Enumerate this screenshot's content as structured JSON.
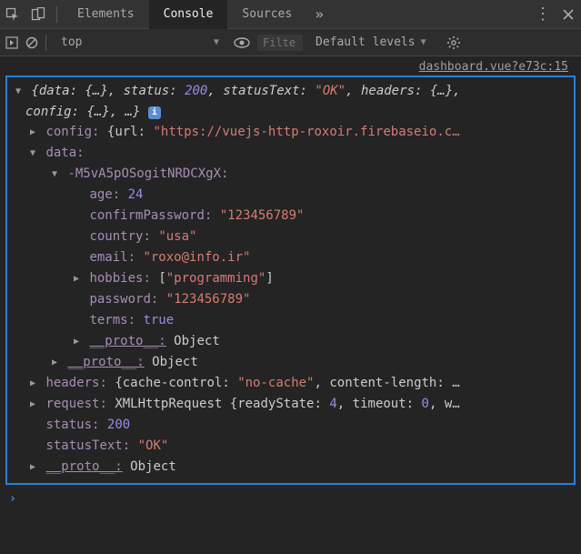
{
  "tabs": {
    "elements": "Elements",
    "console": "Console",
    "sources": "Sources"
  },
  "toolbar": {
    "context": "top",
    "filter_placeholder": "Filter",
    "levels": "Default levels"
  },
  "source_link": "dashboard.vue?e73c:15",
  "summary": {
    "data_k": "data:",
    "data_v": "{…}",
    "status_k": "status:",
    "status_v": "200",
    "statusText_k": "statusText:",
    "statusText_v": "\"OK\"",
    "headers_k": "headers:",
    "headers_v": "{…}",
    "config_k": "config:",
    "config_v": "{…}",
    "ellipsis": "…"
  },
  "config_line": {
    "k": "config:",
    "url_k": "url:",
    "url_v": "\"https://vuejs-http-roxoir.firebaseio.c…"
  },
  "data_key": "data:",
  "record_key": "-M5vA5pOSogitNRDCXgX:",
  "record": {
    "age_k": "age:",
    "age_v": "24",
    "cp_k": "confirmPassword:",
    "cp_v": "\"123456789\"",
    "country_k": "country:",
    "country_v": "\"usa\"",
    "email_k": "email:",
    "email_v": "\"roxo@info.ir\"",
    "hobbies_k": "hobbies:",
    "hobbies_v": "\"programming\"",
    "password_k": "password:",
    "password_v": "\"123456789\"",
    "terms_k": "terms:",
    "terms_v": "true"
  },
  "proto": {
    "k": "__proto__:",
    "v": "Object"
  },
  "headers_line": {
    "k": "headers:",
    "cc_k": "cache-control:",
    "cc_v": "\"no-cache\"",
    "cl_k": "content-length:",
    "tail": "…"
  },
  "request_line": {
    "k": "request:",
    "type": "XMLHttpRequest",
    "rs_k": "readyState:",
    "rs_v": "4",
    "to_k": "timeout:",
    "to_v": "0",
    "tail": "w…"
  },
  "status": {
    "k": "status:",
    "v": "200"
  },
  "statusText": {
    "k": "statusText:",
    "v": "\"OK\""
  }
}
